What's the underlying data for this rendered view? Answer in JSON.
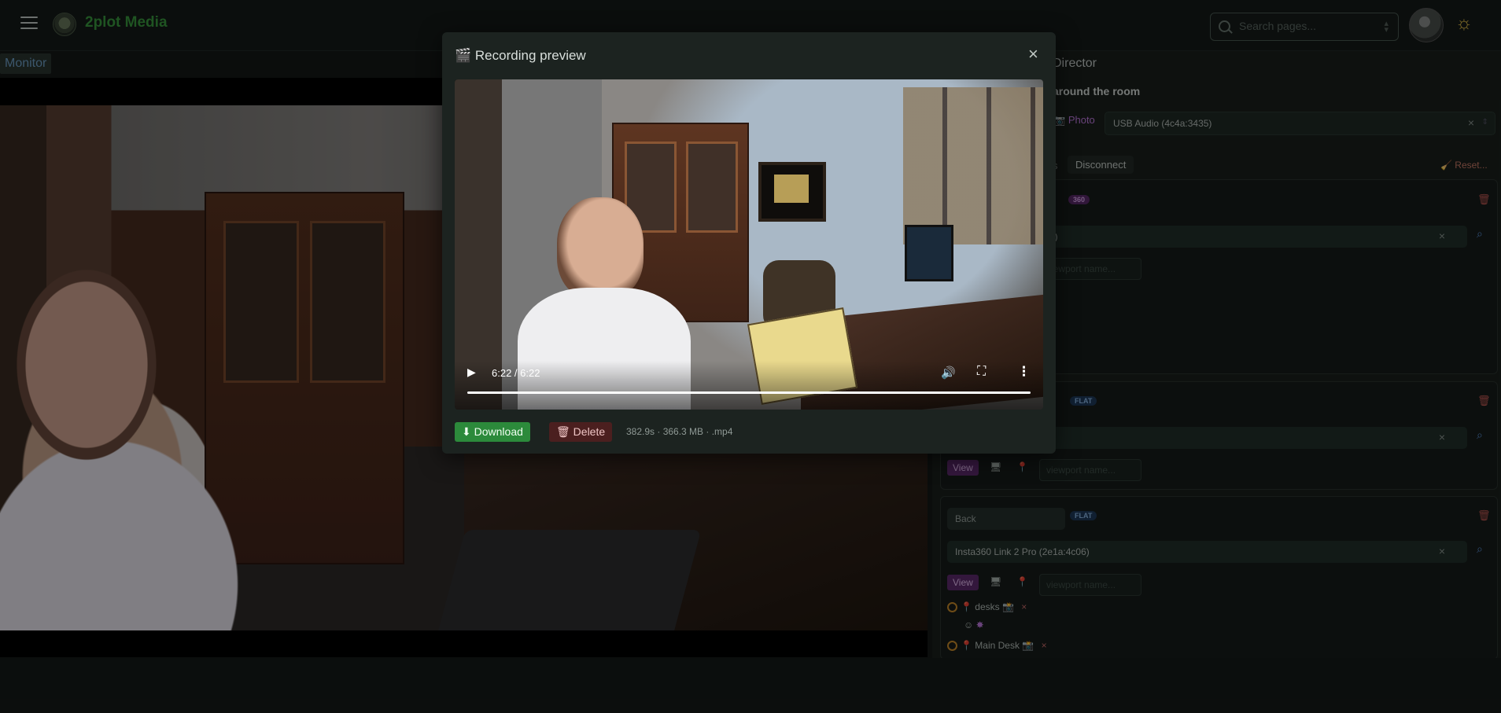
{
  "header": {
    "brand": "2plot Media",
    "search_placeholder": "Search pages..."
  },
  "tabs": {
    "monitor": "Monitor",
    "director": "Director"
  },
  "director_panel": {
    "title": "around the room",
    "photo_label": "Photo",
    "audio_device": "USB Audio (4c4a:3435)",
    "disconnect_label": "Disconnect",
    "s_label": "s",
    "reset_label": "Reset...",
    "cards": [
      {
        "badge": "360",
        "device_fragment": "3)",
        "viewport_placeholder": "viewport name..."
      },
      {
        "badge": "FLAT",
        "view_label": "View",
        "viewport_placeholder": "viewport name..."
      },
      {
        "name": "Back",
        "badge": "FLAT",
        "device": "Insta360 Link 2 Pro (2e1a:4c06)",
        "view_label": "View",
        "viewport_placeholder": "viewport name...",
        "locations": [
          {
            "label": "desks"
          },
          {
            "label": "Main Desk"
          }
        ]
      }
    ]
  },
  "modal": {
    "title": "Recording preview",
    "close_label": "×",
    "time": "6:22 / 6:22",
    "progress": 1.0,
    "download_label": "Download",
    "delete_label": "Delete",
    "file_meta": "382.9s · 366.3 MB · .mp4"
  }
}
